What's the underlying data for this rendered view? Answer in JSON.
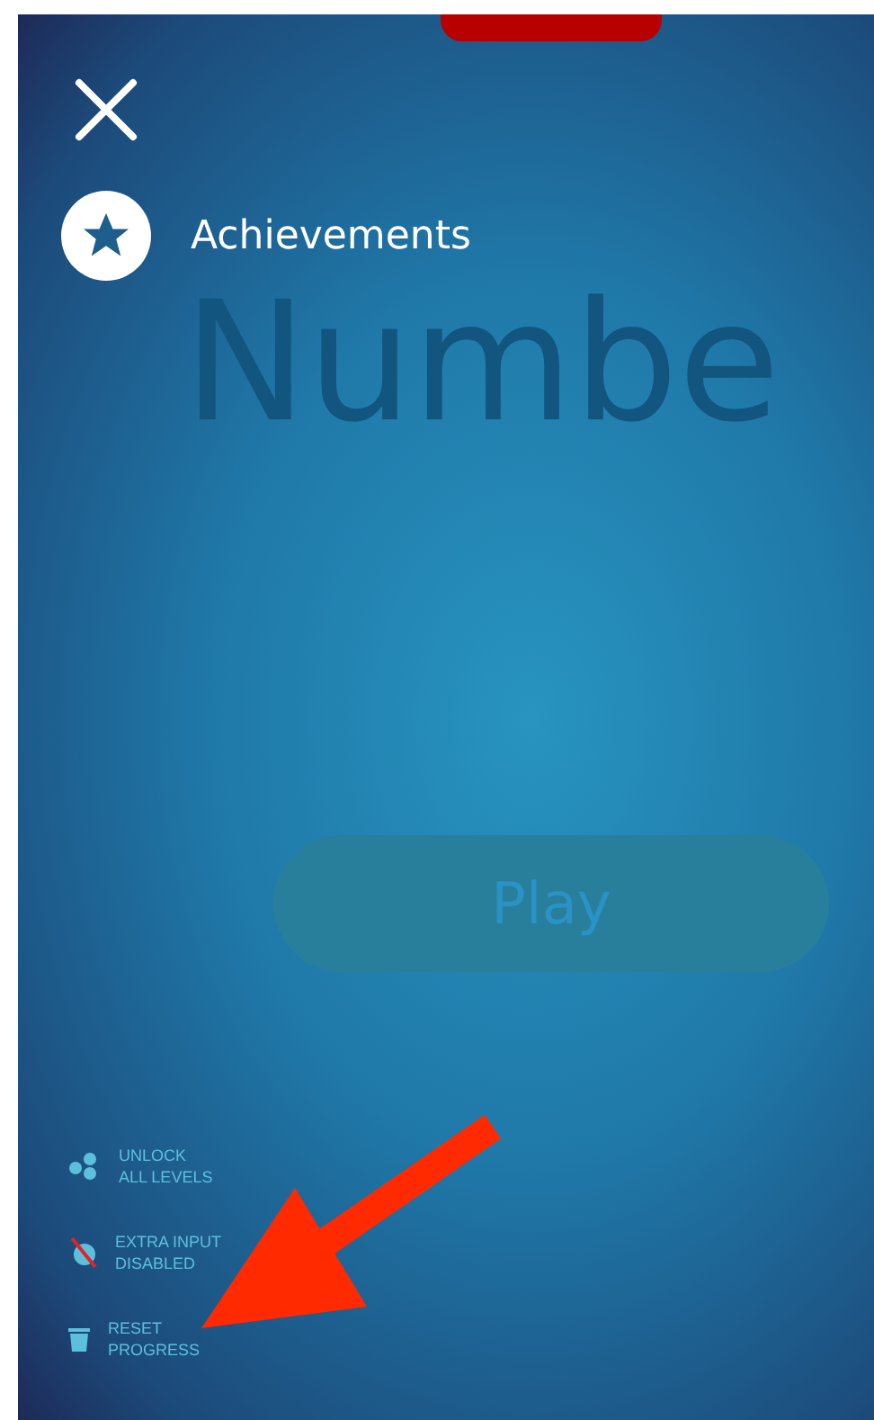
{
  "header": {
    "title": "Achievements"
  },
  "background_title": "Numbe",
  "play_button": {
    "label": "Play",
    "disabled": true
  },
  "options": [
    {
      "kind": "unlock",
      "lines": [
        "UNLOCK",
        "ALL LEVELS"
      ]
    },
    {
      "kind": "input",
      "lines": [
        "EXTRA INPUT",
        "DISABLED"
      ]
    },
    {
      "kind": "reset",
      "lines": [
        "RESET",
        "PROGRESS"
      ]
    }
  ]
}
